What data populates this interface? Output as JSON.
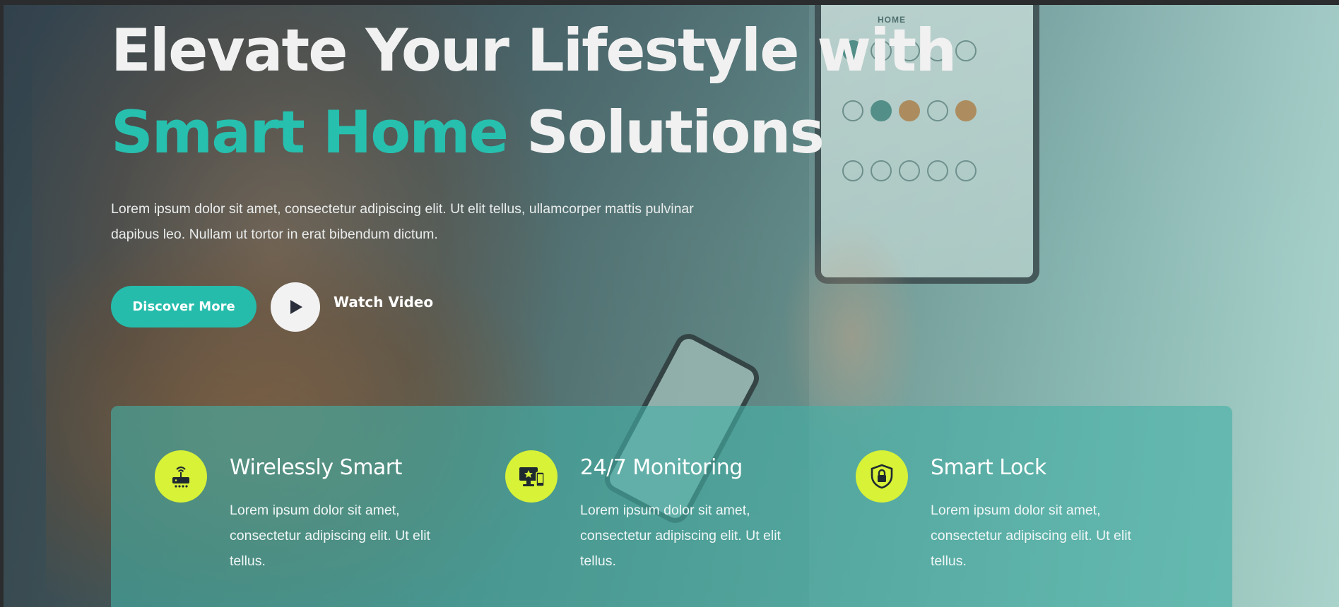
{
  "hero": {
    "title_line1": "Elevate Your Lifestyle with",
    "title_accent": "Smart Home",
    "title_rest": " Solutions",
    "description": "Lorem ipsum dolor sit amet, consectetur adipiscing elit. Ut elit tellus, ullamcorper mattis pulvinar dapibus leo. Nullam ut tortor in erat bibendum dictum.",
    "primary_button": "Discover More",
    "video_link": "Watch Video"
  },
  "features": [
    {
      "icon": "router-icon",
      "title": "Wirelessly Smart",
      "text": "Lorem ipsum dolor sit amet, consectetur adipiscing elit. Ut elit tellus."
    },
    {
      "icon": "monitor-phone-icon",
      "title": "24/7 Monitoring",
      "text": "Lorem ipsum dolor sit amet, consectetur adipiscing elit. Ut elit tellus."
    },
    {
      "icon": "shield-lock-icon",
      "title": "Smart Lock",
      "text": "Lorem ipsum dolor sit amet, consectetur adipiscing elit. Ut elit tellus."
    }
  ],
  "colors": {
    "accent": "#27bfae",
    "icon_bg": "#d7f237",
    "feature_panel": "#44b0a6"
  }
}
